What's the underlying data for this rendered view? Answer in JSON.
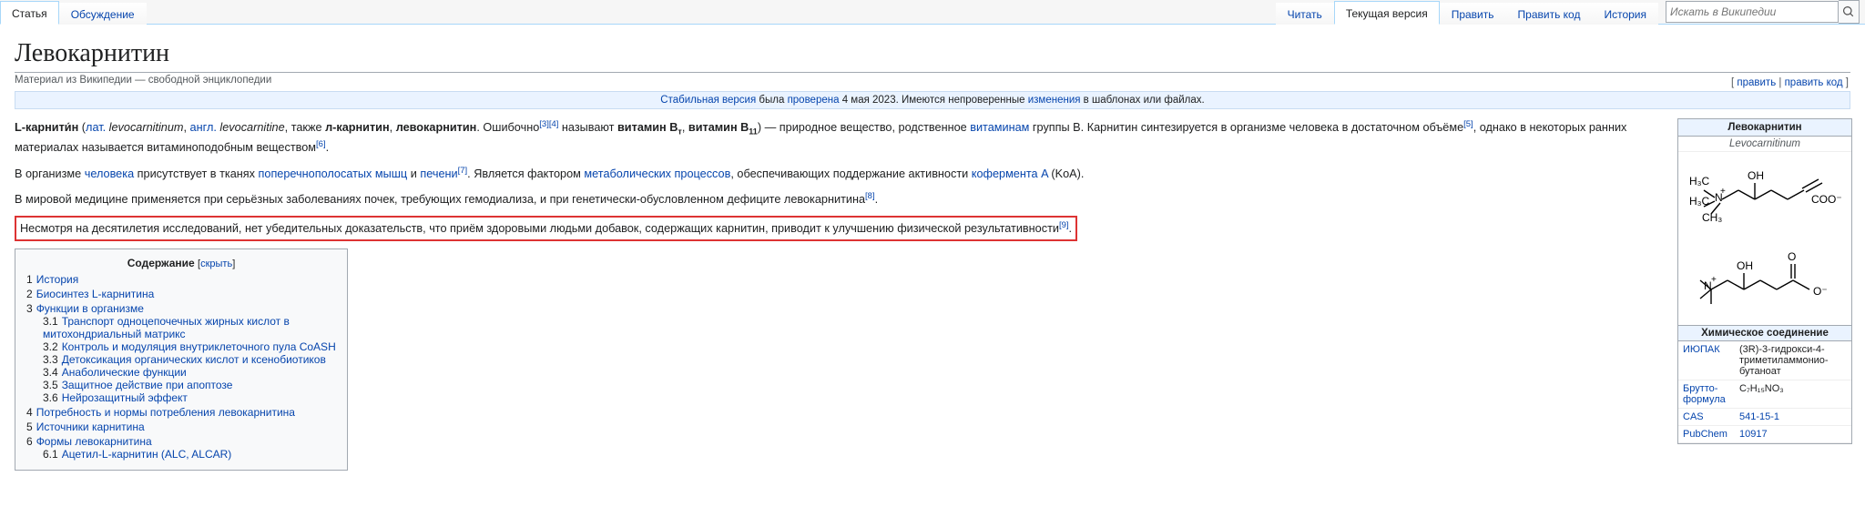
{
  "tabs": {
    "left": [
      "Статья",
      "Обсуждение"
    ],
    "right": [
      "Читать",
      "Текущая версия",
      "Править",
      "Править код",
      "История"
    ],
    "search_placeholder": "Искать в Википедии"
  },
  "heading": "Левокарнитин",
  "siteSub": "Материал из Википедии — свободной энциклопедии",
  "editlinks": {
    "open": "[ ",
    "edit": "править",
    "sep": " | ",
    "editcode": "править код",
    "close": " ]"
  },
  "stable": {
    "a1": "Стабильная версия",
    "t1": " была ",
    "a2": "проверена",
    "t2": " 4 мая 2023",
    "t3": ". Имеются непроверенные ",
    "a3": "изменения",
    "t4": " в шаблонах или файлах."
  },
  "p1": {
    "strong1": "L-карнити́н",
    "t1": " (",
    "lat_lbl": "лат.",
    "lat_val": " levocarnitinum",
    "t2": ", ",
    "en_lbl": "англ.",
    "en_val": " levocarnitine",
    "t3": ", также ",
    "strong2": "л-карнитин",
    "t4": ", ",
    "strong3": "левокарнитин",
    "t5": ". Ошибочно",
    "ref_a": "[3]",
    "ref_b": "[4]",
    "t6": " называют ",
    "strong4": "витамин B",
    "sub_t": "т",
    "t7": ", ",
    "strong5": "витамин B",
    "sub_11": "11",
    "t8": ") — природное вещество, родственное ",
    "link_vit": "витаминам",
    "t9": " группы B. Карнитин синтезируется в организме человека в достаточном объёме",
    "ref_c": "[5]",
    "t10": ", однако в некоторых ранних материалах называется витаминоподобным веществом",
    "ref_d": "[6]",
    "t11": "."
  },
  "p2": {
    "t1": "В организме ",
    "link1": "человека",
    "t2": " присутствует в тканях ",
    "link2": "поперечнополосатых мышц",
    "t3": " и ",
    "link3": "печени",
    "ref": "[7]",
    "t4": ". Является фактором ",
    "link4": "метаболических процессов",
    "t5": ", обеспечивающих поддержание активности ",
    "link5": "кофермента A",
    "t6": " (KoA)."
  },
  "p3": {
    "t1": "В мировой медицине применяется при серьёзных заболеваниях почек, требующих гемодиализа, и при генетически-обусловленном дефиците левокарнитина",
    "ref": "[8]",
    "t2": "."
  },
  "p4": {
    "t1": "Несмотря на десятилетия исследований, нет убедительных доказательств, что приём здоровыми людьми добавок, содержащих карнитин, приводит к улучшению физической результативности",
    "ref": "[9]",
    "t2": "."
  },
  "toc": {
    "title": "Содержание",
    "hide": "скрыть",
    "items": [
      {
        "n": "1",
        "t": "История"
      },
      {
        "n": "2",
        "t": "Биосинтез L-карнитина"
      },
      {
        "n": "3",
        "t": "Функции в организме",
        "sub": [
          {
            "n": "3.1",
            "t": "Транспорт одноцепочечных жирных кислот в митохондриальный матрикс"
          },
          {
            "n": "3.2",
            "t": "Контроль и модуляция внутриклеточного пула CoASH"
          },
          {
            "n": "3.3",
            "t": "Детоксикация органических кислот и ксенобиотиков"
          },
          {
            "n": "3.4",
            "t": "Анаболические функции"
          },
          {
            "n": "3.5",
            "t": "Защитное действие при апоптозе"
          },
          {
            "n": "3.6",
            "t": "Нейрозащитный эффект"
          }
        ]
      },
      {
        "n": "4",
        "t": "Потребность и нормы потребления левокарнитина"
      },
      {
        "n": "5",
        "t": "Источники карнитина"
      },
      {
        "n": "6",
        "t": "Формы левокарнитина",
        "sub": [
          {
            "n": "6.1",
            "t": "Ацетил-L-карнитин (ALC, ALCAR)"
          }
        ]
      }
    ]
  },
  "infobox": {
    "title": "Левокарнитин",
    "latin": "Levocarnitinum",
    "section": "Химическое соединение",
    "rows": [
      {
        "k": "ИЮПАК",
        "v": "(3R)-3-гидрокси-4-триметиламмонио-бутаноат",
        "klink": true
      },
      {
        "k": "Брутто-формула",
        "v": "C₇H₁₅NO₃",
        "klink": true
      },
      {
        "k": "CAS",
        "v": "541-15-1",
        "klink": true,
        "vlink": true
      },
      {
        "k": "PubChem",
        "v": "10917",
        "klink": true,
        "vlink": true
      }
    ]
  }
}
